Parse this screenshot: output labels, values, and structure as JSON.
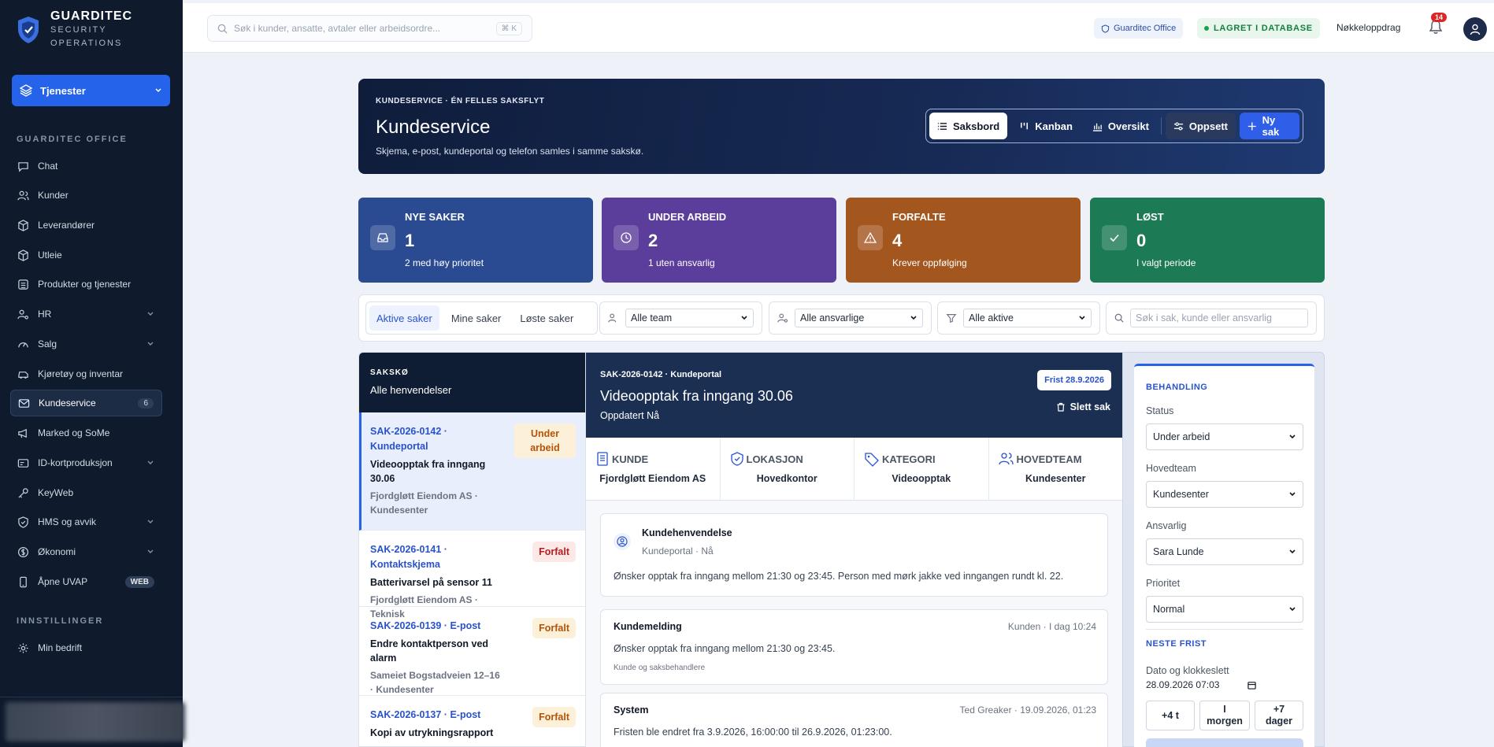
{
  "brand": {
    "name": "GUARDITEC",
    "sub1": "SECURITY",
    "sub2": "OPERATIONS"
  },
  "sidebar": {
    "services_label": "Tjenester",
    "section_office": "GUARDITEC OFFICE",
    "items": [
      {
        "label": "Chat",
        "icon": "chat-icon"
      },
      {
        "label": "Kunder",
        "icon": "users-icon"
      },
      {
        "label": "Leverandører",
        "icon": "box-icon"
      },
      {
        "label": "Utleie",
        "icon": "box-icon"
      },
      {
        "label": "Produkter og tjenester",
        "icon": "list-icon"
      },
      {
        "label": "HR",
        "icon": "user-gear-icon"
      },
      {
        "label": "Salg",
        "icon": "gauge-icon"
      },
      {
        "label": "Kjøretøy og inventar",
        "icon": "car-icon"
      },
      {
        "label": "Kundeservice",
        "icon": "mail-icon",
        "badge": "6"
      },
      {
        "label": "Marked og SoMe",
        "icon": "megaphone-icon"
      },
      {
        "label": "ID-kortproduksjon",
        "icon": "id-card-icon"
      },
      {
        "label": "KeyWeb",
        "icon": "key-icon"
      },
      {
        "label": "HMS og avvik",
        "icon": "shield-check-icon"
      },
      {
        "label": "Økonomi",
        "icon": "coin-icon"
      },
      {
        "label": "Åpne UVAP",
        "icon": "phone-icon",
        "tag": "WEB"
      }
    ],
    "section_settings": "INNSTILLINGER",
    "settings_item": "Min bedrift"
  },
  "topbar": {
    "search_placeholder": "Søk i kunder, ansatte, avtaler eller arbeidsordre...",
    "shortcut": "⌘ K",
    "office_pill": "Guarditec Office",
    "saved_pill": "LAGRET I DATABASE",
    "key_order": "Nøkkeloppdrag",
    "notifications": "14"
  },
  "hero": {
    "kicker": "KUNDESERVICE · ÉN FELLES SAKSFLYT",
    "title": "Kundeservice",
    "subtitle": "Skjema, e-post, kundeportal og telefon samles i samme sakskø.",
    "buttons": {
      "board": "Saksbord",
      "kanban": "Kanban",
      "overview": "Oversikt",
      "setup": "Oppsett",
      "new": "Ny sak"
    }
  },
  "stats": [
    {
      "title": "NYE SAKER",
      "value": "1",
      "sub": "2 med høy prioritet",
      "color": "#2a4a92"
    },
    {
      "title": "UNDER ARBEID",
      "value": "2",
      "sub": "1 uten ansvarlig",
      "color": "#5b3d9c"
    },
    {
      "title": "FORFALTE",
      "value": "4",
      "sub": "Krever oppfølging",
      "color": "#a4561f"
    },
    {
      "title": "LØST",
      "value": "0",
      "sub": "I valgt periode",
      "color": "#1c7a55"
    }
  ],
  "filters": {
    "tabs": [
      "Aktive saker",
      "Mine saker",
      "Løste saker"
    ],
    "team": "Alle team",
    "responsible": "Alle ansvarlige",
    "active": "Alle aktive",
    "search_placeholder": "Søk i sak, kunde eller ansvarlig"
  },
  "queue": {
    "kicker": "SAKSKØ",
    "title": "Alle henvendelser",
    "items": [
      {
        "id": "SAK-2026-0142 · Kundeportal",
        "title": "Videoopptak fra inngang 30.06",
        "meta": "Fjordgløtt Eiendom AS · Kundesenter",
        "badge": "Under arbeid"
      },
      {
        "id": "SAK-2026-0141 · Kontaktskjema",
        "title": "Batterivarsel på sensor 11",
        "meta": "Fjordgløtt Eiendom AS · Teknisk",
        "badge": "Forfalt"
      },
      {
        "id": "SAK-2026-0139 · E-post",
        "title": "Endre kontaktperson ved alarm",
        "meta": "Sameiet Bogstadveien 12–16 · Kundesenter",
        "badge": "Forfalt"
      },
      {
        "id": "SAK-2026-0137 · E-post",
        "title": "Kopi av utrykningsrapport",
        "meta": "",
        "badge": "Forfalt"
      }
    ]
  },
  "detail": {
    "kicker": "SAK-2026-0142 · Kundeportal",
    "title": "Videoopptak fra inngang 30.06",
    "updated": "Oppdatert Nå",
    "due": "Frist 28.9.2026",
    "delete": "Slett sak",
    "info": [
      {
        "label": "KUNDE",
        "value": "Fjordgløtt Eiendom AS"
      },
      {
        "label": "LOKASJON",
        "value": "Hovedkontor"
      },
      {
        "label": "KATEGORI",
        "value": "Videoopptak"
      },
      {
        "label": "HOVEDTEAM",
        "value": "Kundesenter"
      }
    ],
    "inquiry": {
      "title": "Kundehenvendelse",
      "meta": "Kundeportal · Nå",
      "body": "Ønsker opptak fra inngang mellom 21:30 og 23:45. Person med mørk jakke ved inngangen rundt kl. 22."
    },
    "message": {
      "title": "Kundemelding",
      "meta": "Kunden · I dag 10:24",
      "body": "Ønsker opptak fra inngang mellom 21:30 og 23:45.",
      "note": "Kunde og saksbehandlere"
    },
    "system": {
      "title": "System",
      "meta": "Ted Greaker · 19.09.2026, 01:23",
      "body": "Fristen ble endret fra 3.9.2026, 16:00:00 til 26.9.2026, 01:23:00."
    }
  },
  "panel": {
    "heading": "BEHANDLING",
    "status_label": "Status",
    "status": "Under arbeid",
    "team_label": "Hovedteam",
    "team": "Kundesenter",
    "resp_label": "Ansvarlig",
    "resp": "Sara Lunde",
    "prio_label": "Prioritet",
    "prio": "Normal",
    "next_heading": "NESTE FRIST",
    "date_label": "Dato og klokkeslett",
    "date_value": "28.09.2026 07:03",
    "quick": [
      "+4 t",
      "I morgen",
      "+7 dager"
    ]
  }
}
